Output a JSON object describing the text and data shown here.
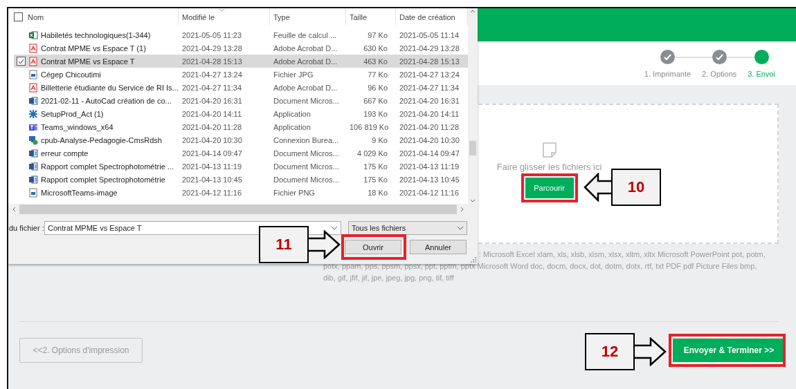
{
  "stepper": {
    "steps": [
      {
        "label": "1. Imprimante",
        "completed": true
      },
      {
        "label": "2. Options",
        "completed": true
      },
      {
        "label": "3. Envoi",
        "completed": false
      }
    ]
  },
  "dropzone": {
    "hint": "Faire glisser les fichiers ici",
    "browse_button": {
      "label": "Parcourir",
      "highlighted": true
    }
  },
  "accepted_types": [
    ": Microsoft Excel xlam, xls, xlsb, xlsm, xlsx, xltm, xltx Microsoft PowerPoint pot, potm,",
    "potx, ppam, pps, ppsm, ppsx, ppt, pptm, pptx Microsoft Word doc, docm, docx, dot, dotm, dotx, rtf, txt PDF pdf Picture Files bmp, dib, gif, jfif, jif, jpe, jpeg, jpg, png, tif, tiff"
  ],
  "back_button": {
    "label": "<<2. Options d'impression"
  },
  "submit_button": {
    "label": "Envoyer & Terminer >>",
    "highlighted": true
  },
  "file_dialog": {
    "select_all_checked": false,
    "columns": [
      "Nom",
      "Modifié le",
      "Type",
      "Taille",
      "Date de création"
    ],
    "rows": [
      {
        "name": "Habiletés technologiques(1-344)",
        "modified": "2021-05-05 11:23",
        "type": "Feuille de calcul ...",
        "size": "97 Ko",
        "created": "2021-05-05 11:14",
        "kind": "excel",
        "selected": false
      },
      {
        "name": "Contrat MPME vs Espace T (1)",
        "modified": "2021-04-29 13:28",
        "type": "Adobe Acrobat D...",
        "size": "630 Ko",
        "created": "2021-04-29 13:28",
        "kind": "pdf",
        "selected": false
      },
      {
        "name": "Contrat MPME vs Espace T",
        "modified": "2021-04-28 15:13",
        "type": "Adobe Acrobat D...",
        "size": "463 Ko",
        "created": "2021-04-28 15:13",
        "kind": "pdf",
        "selected": true
      },
      {
        "name": "Cégep Chicoutimi",
        "modified": "2021-04-27 13:24",
        "type": "Fichier JPG",
        "size": "77 Ko",
        "created": "2021-04-27 13:24",
        "kind": "image",
        "selected": false
      },
      {
        "name": "Billetterie étudiante du Service de RI Is...",
        "modified": "2021-04-27 11:34",
        "type": "Adobe Acrobat D...",
        "size": "96 Ko",
        "created": "2021-04-27 11:34",
        "kind": "pdf",
        "selected": false
      },
      {
        "name": "2021-02-11 - AutoCad création de co...",
        "modified": "2021-04-20 16:31",
        "type": "Document Micros...",
        "size": "667 Ko",
        "created": "2021-04-20 16:31",
        "kind": "word",
        "selected": false
      },
      {
        "name": "SetupProd_Act (1)",
        "modified": "2021-04-20 14:11",
        "type": "Application",
        "size": "193 Ko",
        "created": "2021-04-20 14:11",
        "kind": "setup",
        "selected": false
      },
      {
        "name": "Teams_windows_x64",
        "modified": "2021-04-20 11:28",
        "type": "Application",
        "size": "106 819 Ko",
        "created": "2021-04-20 11:28",
        "kind": "teams",
        "selected": false
      },
      {
        "name": "cpub-Analyse-Pedagogie-CmsRdsh",
        "modified": "2021-04-20 10:30",
        "type": "Connexion Burea...",
        "size": "9 Ko",
        "created": "2021-04-20 10:30",
        "kind": "remote",
        "selected": false
      },
      {
        "name": "erreur compte",
        "modified": "2021-04-14 09:47",
        "type": "Document Micros...",
        "size": "4 029 Ko",
        "created": "2021-04-14 09:47",
        "kind": "word",
        "selected": false
      },
      {
        "name": "Rapport complet Spectrophotométrie ...",
        "modified": "2021-04-13 11:19",
        "type": "Document Micros...",
        "size": "175 Ko",
        "created": "2021-04-13 11:19",
        "kind": "word",
        "selected": false
      },
      {
        "name": "Rapport complet Spectrophotométrie",
        "modified": "2021-04-13 10:45",
        "type": "Document Micros...",
        "size": "175 Ko",
        "created": "2021-04-13 10:45",
        "kind": "word",
        "selected": false
      },
      {
        "name": "MicrosoftTeams-image",
        "modified": "2021-04-12 11:16",
        "type": "Fichier PNG",
        "size": "18 Ko",
        "created": "2021-04-12 11:16",
        "kind": "image",
        "selected": false
      }
    ],
    "filename_label": "du fichier :",
    "filename_value": "Contrat MPME vs Espace T",
    "filter": "Tous les fichiers",
    "open_button": {
      "label": "Ouvrir",
      "highlighted": true
    },
    "cancel_button": {
      "label": "Annuler"
    }
  },
  "callouts": [
    {
      "number": "10",
      "kind": "left"
    },
    {
      "number": "11",
      "kind": "right"
    },
    {
      "number": "12",
      "kind": "right"
    }
  ]
}
